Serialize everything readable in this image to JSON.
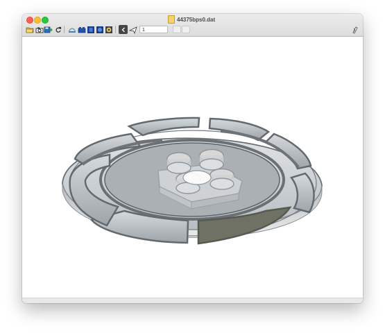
{
  "window": {
    "title": "44375bps0.dat"
  },
  "toolbar": {
    "frame_value": "1",
    "buttons": [
      "open-icon",
      "camera-icon",
      "save-icon",
      "reload-icon",
      "overview-icon",
      "brick-icon",
      "blue-square-icon",
      "blue-circle-icon",
      "help-icon",
      "back-icon",
      "plane-icon",
      "undo-icon",
      "redo-icon",
      "script-icon"
    ]
  },
  "colors": {
    "disk_light": "#c9ced1",
    "disk_dark": "#8d9296",
    "dark_panel": "#6e7164",
    "stud_transparent": "#d8d8d8"
  }
}
